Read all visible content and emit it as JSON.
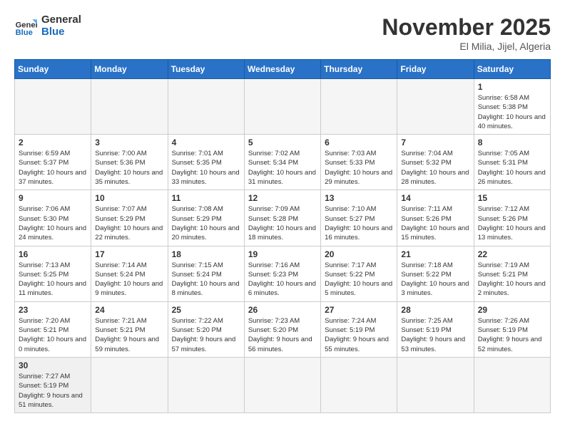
{
  "header": {
    "logo_general": "General",
    "logo_blue": "Blue",
    "month_title": "November 2025",
    "location": "El Milia, Jijel, Algeria"
  },
  "days_of_week": [
    "Sunday",
    "Monday",
    "Tuesday",
    "Wednesday",
    "Thursday",
    "Friday",
    "Saturday"
  ],
  "weeks": [
    [
      {
        "day": "",
        "info": ""
      },
      {
        "day": "",
        "info": ""
      },
      {
        "day": "",
        "info": ""
      },
      {
        "day": "",
        "info": ""
      },
      {
        "day": "",
        "info": ""
      },
      {
        "day": "",
        "info": ""
      },
      {
        "day": "1",
        "info": "Sunrise: 6:58 AM\nSunset: 5:38 PM\nDaylight: 10 hours and 40 minutes."
      }
    ],
    [
      {
        "day": "2",
        "info": "Sunrise: 6:59 AM\nSunset: 5:37 PM\nDaylight: 10 hours and 37 minutes."
      },
      {
        "day": "3",
        "info": "Sunrise: 7:00 AM\nSunset: 5:36 PM\nDaylight: 10 hours and 35 minutes."
      },
      {
        "day": "4",
        "info": "Sunrise: 7:01 AM\nSunset: 5:35 PM\nDaylight: 10 hours and 33 minutes."
      },
      {
        "day": "5",
        "info": "Sunrise: 7:02 AM\nSunset: 5:34 PM\nDaylight: 10 hours and 31 minutes."
      },
      {
        "day": "6",
        "info": "Sunrise: 7:03 AM\nSunset: 5:33 PM\nDaylight: 10 hours and 29 minutes."
      },
      {
        "day": "7",
        "info": "Sunrise: 7:04 AM\nSunset: 5:32 PM\nDaylight: 10 hours and 28 minutes."
      },
      {
        "day": "8",
        "info": "Sunrise: 7:05 AM\nSunset: 5:31 PM\nDaylight: 10 hours and 26 minutes."
      }
    ],
    [
      {
        "day": "9",
        "info": "Sunrise: 7:06 AM\nSunset: 5:30 PM\nDaylight: 10 hours and 24 minutes."
      },
      {
        "day": "10",
        "info": "Sunrise: 7:07 AM\nSunset: 5:29 PM\nDaylight: 10 hours and 22 minutes."
      },
      {
        "day": "11",
        "info": "Sunrise: 7:08 AM\nSunset: 5:29 PM\nDaylight: 10 hours and 20 minutes."
      },
      {
        "day": "12",
        "info": "Sunrise: 7:09 AM\nSunset: 5:28 PM\nDaylight: 10 hours and 18 minutes."
      },
      {
        "day": "13",
        "info": "Sunrise: 7:10 AM\nSunset: 5:27 PM\nDaylight: 10 hours and 16 minutes."
      },
      {
        "day": "14",
        "info": "Sunrise: 7:11 AM\nSunset: 5:26 PM\nDaylight: 10 hours and 15 minutes."
      },
      {
        "day": "15",
        "info": "Sunrise: 7:12 AM\nSunset: 5:26 PM\nDaylight: 10 hours and 13 minutes."
      }
    ],
    [
      {
        "day": "16",
        "info": "Sunrise: 7:13 AM\nSunset: 5:25 PM\nDaylight: 10 hours and 11 minutes."
      },
      {
        "day": "17",
        "info": "Sunrise: 7:14 AM\nSunset: 5:24 PM\nDaylight: 10 hours and 9 minutes."
      },
      {
        "day": "18",
        "info": "Sunrise: 7:15 AM\nSunset: 5:24 PM\nDaylight: 10 hours and 8 minutes."
      },
      {
        "day": "19",
        "info": "Sunrise: 7:16 AM\nSunset: 5:23 PM\nDaylight: 10 hours and 6 minutes."
      },
      {
        "day": "20",
        "info": "Sunrise: 7:17 AM\nSunset: 5:22 PM\nDaylight: 10 hours and 5 minutes."
      },
      {
        "day": "21",
        "info": "Sunrise: 7:18 AM\nSunset: 5:22 PM\nDaylight: 10 hours and 3 minutes."
      },
      {
        "day": "22",
        "info": "Sunrise: 7:19 AM\nSunset: 5:21 PM\nDaylight: 10 hours and 2 minutes."
      }
    ],
    [
      {
        "day": "23",
        "info": "Sunrise: 7:20 AM\nSunset: 5:21 PM\nDaylight: 10 hours and 0 minutes."
      },
      {
        "day": "24",
        "info": "Sunrise: 7:21 AM\nSunset: 5:21 PM\nDaylight: 9 hours and 59 minutes."
      },
      {
        "day": "25",
        "info": "Sunrise: 7:22 AM\nSunset: 5:20 PM\nDaylight: 9 hours and 57 minutes."
      },
      {
        "day": "26",
        "info": "Sunrise: 7:23 AM\nSunset: 5:20 PM\nDaylight: 9 hours and 56 minutes."
      },
      {
        "day": "27",
        "info": "Sunrise: 7:24 AM\nSunset: 5:19 PM\nDaylight: 9 hours and 55 minutes."
      },
      {
        "day": "28",
        "info": "Sunrise: 7:25 AM\nSunset: 5:19 PM\nDaylight: 9 hours and 53 minutes."
      },
      {
        "day": "29",
        "info": "Sunrise: 7:26 AM\nSunset: 5:19 PM\nDaylight: 9 hours and 52 minutes."
      }
    ],
    [
      {
        "day": "30",
        "info": "Sunrise: 7:27 AM\nSunset: 5:19 PM\nDaylight: 9 hours and 51 minutes."
      },
      {
        "day": "",
        "info": ""
      },
      {
        "day": "",
        "info": ""
      },
      {
        "day": "",
        "info": ""
      },
      {
        "day": "",
        "info": ""
      },
      {
        "day": "",
        "info": ""
      },
      {
        "day": "",
        "info": ""
      }
    ]
  ]
}
